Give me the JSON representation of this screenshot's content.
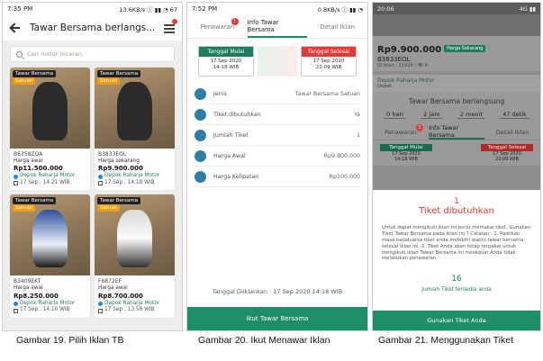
{
  "screen1": {
    "status_time": "7:35 PM",
    "status_right": "13.6KB/s ⓘ ▮▮ ◔ 67",
    "title": "Tawar Bersama berlangs...",
    "search_placeholder": "Cari motor incaran",
    "cards": [
      {
        "tag": "Tawar Bersama",
        "tag2": "Satuan",
        "plate": "B6358ZOA",
        "price_label": "Harga awal",
        "price": "Rp11.500.000",
        "dealer": "Depok Raharja Motor",
        "date": "17 Sep , 14.21 WIB"
      },
      {
        "tag": "Tawar Bersama",
        "tag2": "Satuan",
        "plate": "B3833EOL",
        "price_label": "Harga sekarang",
        "price": "Rp9.900.000",
        "dealer": "Depok Raharja Motor",
        "date": "17 Sep , 14.18 WIB"
      },
      {
        "tag": "Tawar Bersama",
        "tag2": "Satuan",
        "plate": "B3409EKT",
        "price_label": "Harga awal",
        "price": "Rp8.250.000",
        "dealer": "Depok Raharja Motor",
        "date": "17 Sep , 14.10 WIB"
      },
      {
        "tag": "Tawar Bersama",
        "tag2": "Satuan",
        "plate": "F6872EF",
        "price_label": "Harga awal",
        "price": "Rp8.700.000",
        "dealer": "Depok Raharja Motor",
        "date": "17 Sep , 13.58 WIB"
      }
    ]
  },
  "screen2": {
    "status_time": "7:52 PM",
    "status_right": "0.8KB/s ⓘ ▮▮ ◔",
    "tabs": [
      {
        "label": "Penawaran",
        "badge": "1"
      },
      {
        "label": "Info Tawar Bersama"
      },
      {
        "label": "Detail Iklan"
      }
    ],
    "start": {
      "label": "Tanggal Mulai",
      "date": "17 Sep 2020",
      "time": "14:18 WIB"
    },
    "end": {
      "label": "Tanggal Selesai",
      "date": "17 Sep 2020",
      "time": "22:09 WIB"
    },
    "rows": [
      {
        "label": "Jenis",
        "value": "Tawar Bersama Satuan"
      },
      {
        "label": "Tiket dibutuhkan",
        "value": "Ya"
      },
      {
        "label": "Jumlah Tiket",
        "value": "1"
      },
      {
        "label": "Harga Awal",
        "value": "Rp9.800.000"
      },
      {
        "label": "Harga Kelipatan",
        "value": "Rp100.000"
      }
    ],
    "posted": "Tanggal Diiklankan : 17 Sep 2020 14:18 WIB",
    "cta": "Ikut Tawar Bersama"
  },
  "screen3": {
    "status_time": "20:06",
    "status_right": "4G ▮▮",
    "price": "Rp9.900.000",
    "pill": "Harga Sekarang",
    "plate": "B3833EOL",
    "small": "ID Iklan : 11929 | 👁 9",
    "dealer": "Depok Raharja Motor",
    "dealer_sub": "Depok",
    "section_title": "Tawar Bersama berlangsung",
    "countdown": [
      "0 hari",
      "2 jam",
      "2 menit",
      "47 detik"
    ],
    "tabs": [
      {
        "label": "Penawaran",
        "badge": "1"
      },
      {
        "label": "Info Tawar Bersama"
      },
      {
        "label": "Detail Iklan"
      }
    ],
    "start": {
      "label": "Tanggal Mulai",
      "date": "17 Sep 2020",
      "time": "14:18 WIB"
    },
    "end": {
      "label": "Tanggal Selesai",
      "date": "17 Sep 2020",
      "time": "22:09 WIB"
    },
    "sheet": {
      "count": "1",
      "title": "Tiket dibutuhkan",
      "desc": "Untuk dapat mengikuti iklan ini perlu memakai tiket. Gunakan Tiket Tawar Bersama pada iklan ini ? Catatan : 1. Pastikan masa kadaluarsa tiket anda melebihi waktu tawar bersama selesai iklan ini. 2. Tiket Anda akan tetap terpakai untuk mengikuti iklan Tawar Bersama ini meskipun Anda tidak melakukan penawaran.",
      "available": "16",
      "available_label": "Jumlah Tiket tersedia anda",
      "cta": "Gunakan Tiket Anda"
    }
  },
  "captions": [
    "Gambar 19. Pilih Iklan TB",
    "Gambar 20. Ikut Menawar Iklan",
    "Gambar 21. Menggunakan Tiket"
  ],
  "colors": {
    "brand": "#1e8e6a",
    "start": "#1e7e5b",
    "end": "#e53935"
  }
}
